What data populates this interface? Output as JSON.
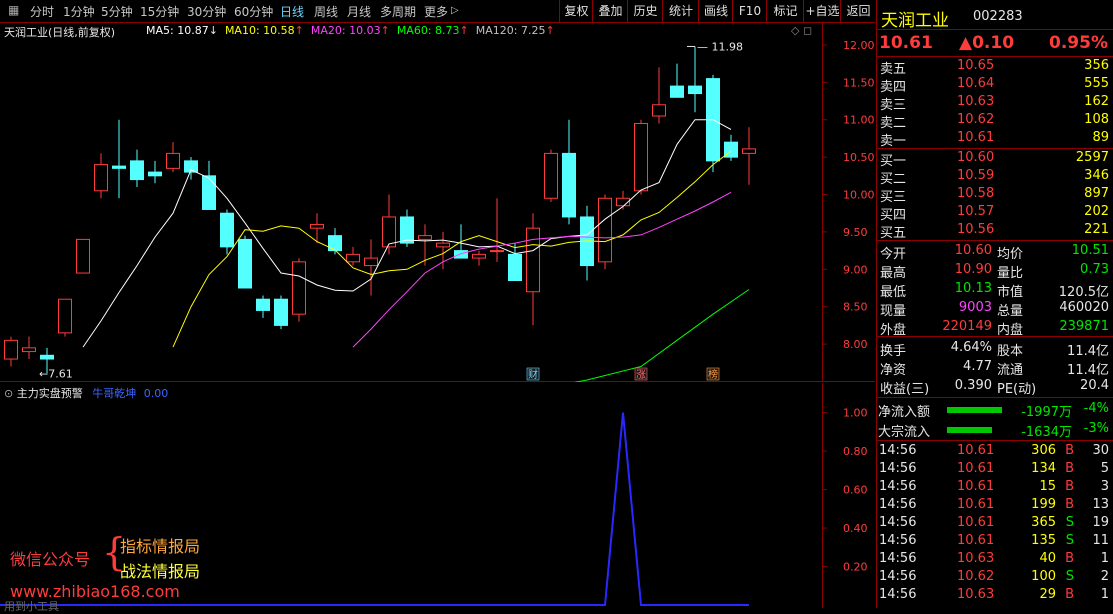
{
  "toolbar": {
    "periods": [
      {
        "label": "分时",
        "active": false
      },
      {
        "label": "1分钟",
        "active": false
      },
      {
        "label": "5分钟",
        "active": false
      },
      {
        "label": "15分钟",
        "active": false
      },
      {
        "label": "30分钟",
        "active": false
      },
      {
        "label": "60分钟",
        "active": false
      },
      {
        "label": "日线",
        "active": true
      },
      {
        "label": "周线",
        "active": false
      },
      {
        "label": "月线",
        "active": false
      },
      {
        "label": "多周期",
        "active": false
      },
      {
        "label": "更多",
        "active": false
      }
    ],
    "buttons": [
      "复权",
      "叠加",
      "历史",
      "统计",
      "画线",
      "F10",
      "标记",
      "+自选",
      "返回"
    ]
  },
  "main_chart": {
    "title": "天润工业(日线,前复权)",
    "ma_legend": [
      {
        "label": "MA5: 10.87",
        "arrow": "↓",
        "color": "#ffffff"
      },
      {
        "label": "MA10: 10.58",
        "arrow": "↑",
        "color": "#ffff00"
      },
      {
        "label": "MA20: 10.03",
        "arrow": "↑",
        "color": "#ff44ff"
      },
      {
        "label": "MA60: 8.73",
        "arrow": "↑",
        "color": "#00ff00"
      },
      {
        "label": "MA120: 7.25",
        "arrow": "↑",
        "color": "#c0c0c0"
      }
    ],
    "price_axis": [
      "12.00",
      "11.50",
      "11.00",
      "10.50",
      "10.00",
      "9.50",
      "9.00",
      "8.50",
      "8.00"
    ],
    "high_label": "11.98",
    "low_label": "7.61",
    "event_markers": [
      {
        "text": "财",
        "color": "#6ad6ff"
      },
      {
        "text": "涨",
        "color": "#ff6a6a"
      },
      {
        "text": "榜",
        "color": "#ff9b3c"
      }
    ]
  },
  "chart_data": {
    "type": "candlestick",
    "ylim": [
      7.6,
      12.2
    ],
    "candles": [
      {
        "o": 7.8,
        "h": 8.1,
        "l": 7.7,
        "c": 8.05
      },
      {
        "o": 7.9,
        "h": 8.1,
        "l": 7.8,
        "c": 7.95
      },
      {
        "o": 7.85,
        "h": 7.95,
        "l": 7.61,
        "c": 7.8
      },
      {
        "o": 8.15,
        "h": 8.6,
        "l": 8.1,
        "c": 8.6
      },
      {
        "o": 8.95,
        "h": 9.4,
        "l": 8.95,
        "c": 9.4
      },
      {
        "o": 10.05,
        "h": 10.55,
        "l": 9.95,
        "c": 10.4
      },
      {
        "o": 10.38,
        "h": 11.0,
        "l": 9.95,
        "c": 10.35
      },
      {
        "o": 10.45,
        "h": 10.6,
        "l": 10.1,
        "c": 10.2
      },
      {
        "o": 10.3,
        "h": 10.45,
        "l": 10.15,
        "c": 10.25
      },
      {
        "o": 10.35,
        "h": 10.7,
        "l": 10.3,
        "c": 10.55
      },
      {
        "o": 10.45,
        "h": 10.5,
        "l": 10.2,
        "c": 10.3
      },
      {
        "o": 10.25,
        "h": 10.45,
        "l": 9.8,
        "c": 9.8
      },
      {
        "o": 9.75,
        "h": 9.8,
        "l": 9.2,
        "c": 9.3
      },
      {
        "o": 9.4,
        "h": 9.45,
        "l": 8.75,
        "c": 8.75
      },
      {
        "o": 8.6,
        "h": 8.65,
        "l": 8.35,
        "c": 8.45
      },
      {
        "o": 8.6,
        "h": 8.65,
        "l": 8.2,
        "c": 8.25
      },
      {
        "o": 8.4,
        "h": 9.15,
        "l": 8.3,
        "c": 9.1
      },
      {
        "o": 9.55,
        "h": 9.75,
        "l": 9.35,
        "c": 9.6
      },
      {
        "o": 9.45,
        "h": 9.55,
        "l": 9.2,
        "c": 9.25
      },
      {
        "o": 9.1,
        "h": 9.3,
        "l": 9.05,
        "c": 9.2
      },
      {
        "o": 9.05,
        "h": 9.4,
        "l": 8.65,
        "c": 9.15
      },
      {
        "o": 9.3,
        "h": 10.0,
        "l": 9.2,
        "c": 9.7
      },
      {
        "o": 9.7,
        "h": 9.8,
        "l": 9.3,
        "c": 9.35
      },
      {
        "o": 9.4,
        "h": 9.6,
        "l": 9.05,
        "c": 9.45
      },
      {
        "o": 9.3,
        "h": 9.5,
        "l": 9.0,
        "c": 9.35
      },
      {
        "o": 9.25,
        "h": 9.6,
        "l": 9.15,
        "c": 9.15
      },
      {
        "o": 9.15,
        "h": 9.25,
        "l": 9.05,
        "c": 9.2
      },
      {
        "o": 9.25,
        "h": 9.95,
        "l": 9.1,
        "c": 9.25
      },
      {
        "o": 9.2,
        "h": 9.35,
        "l": 8.85,
        "c": 8.85
      },
      {
        "o": 8.7,
        "h": 9.75,
        "l": 8.25,
        "c": 9.55
      },
      {
        "o": 9.95,
        "h": 10.6,
        "l": 9.9,
        "c": 10.55
      },
      {
        "o": 10.55,
        "h": 11.0,
        "l": 9.6,
        "c": 9.7
      },
      {
        "o": 9.7,
        "h": 9.85,
        "l": 8.85,
        "c": 9.05
      },
      {
        "o": 9.1,
        "h": 10.0,
        "l": 9.0,
        "c": 9.95
      },
      {
        "o": 9.85,
        "h": 10.05,
        "l": 9.8,
        "c": 9.95
      },
      {
        "o": 10.05,
        "h": 11.0,
        "l": 10.0,
        "c": 10.95
      },
      {
        "o": 11.05,
        "h": 11.7,
        "l": 10.95,
        "c": 11.2
      },
      {
        "o": 11.45,
        "h": 11.75,
        "l": 11.3,
        "c": 11.3
      },
      {
        "o": 11.45,
        "h": 11.98,
        "l": 11.1,
        "c": 11.35
      },
      {
        "o": 11.55,
        "h": 11.6,
        "l": 10.3,
        "c": 10.45
      },
      {
        "o": 10.7,
        "h": 10.8,
        "l": 10.45,
        "c": 10.5
      },
      {
        "o": 10.55,
        "h": 10.9,
        "l": 10.13,
        "c": 10.61
      }
    ],
    "ma5": [
      null,
      null,
      null,
      null,
      7.96,
      8.31,
      8.69,
      9.05,
      9.43,
      9.75,
      10.33,
      10.22,
      9.95,
      9.62,
      9.28,
      8.95,
      8.91,
      8.79,
      8.72,
      8.71,
      8.87,
      9.34,
      9.39,
      9.38,
      9.39,
      9.35,
      9.3,
      9.31,
      9.21,
      9.25,
      9.41,
      9.44,
      9.46,
      9.67,
      9.84,
      10.06,
      10.16,
      10.67,
      11.0,
      11.0,
      10.87
    ],
    "ma10": [
      null,
      null,
      null,
      null,
      null,
      null,
      null,
      null,
      null,
      7.96,
      8.5,
      8.93,
      9.17,
      9.53,
      9.51,
      9.58,
      9.55,
      9.37,
      9.26,
      9.02,
      8.93,
      8.98,
      9.0,
      9.12,
      9.21,
      9.37,
      9.45,
      9.37,
      9.29,
      9.33,
      9.31,
      9.36,
      9.38,
      9.37,
      9.46,
      9.66,
      9.76,
      9.96,
      10.17,
      10.4,
      10.58
    ],
    "ma20": [
      null,
      null,
      null,
      null,
      null,
      null,
      null,
      null,
      null,
      null,
      null,
      null,
      null,
      null,
      null,
      null,
      null,
      null,
      null,
      7.96,
      8.2,
      8.46,
      8.7,
      8.95,
      9.1,
      9.21,
      9.27,
      9.31,
      9.35,
      9.4,
      9.42,
      9.44,
      9.43,
      9.42,
      9.43,
      9.46,
      9.56,
      9.67,
      9.78,
      9.9,
      10.03
    ],
    "ma60": [
      {
        "i": 25,
        "v": 7.27
      },
      {
        "i": 29,
        "v": 7.38
      },
      {
        "i": 32,
        "v": 7.52
      },
      {
        "i": 35,
        "v": 7.7
      },
      {
        "i": 37,
        "v": 8.05
      },
      {
        "i": 39,
        "v": 8.4
      },
      {
        "i": 41,
        "v": 8.73
      }
    ]
  },
  "indicator": {
    "title": "主力实盘预警",
    "series_name": "牛哥乾坤",
    "series_value": "0.00",
    "axis": [
      "1.00",
      "0.80",
      "0.60",
      "0.40",
      "0.20"
    ],
    "ylim": [
      0,
      1.05
    ],
    "values": [
      0,
      0,
      0,
      0,
      0,
      0,
      0,
      0,
      0,
      0,
      0,
      0,
      0,
      0,
      0,
      0,
      0,
      0,
      0,
      0,
      0,
      0,
      0,
      0,
      0,
      0,
      0,
      0,
      0,
      0,
      0,
      0,
      0,
      0,
      1,
      0,
      0,
      0,
      0,
      0,
      0,
      0
    ]
  },
  "watermark": {
    "wechat": "微信公众号",
    "line1": "指标情报局",
    "line2": "战法情报局",
    "site": "www.zhibiao168.com",
    "note": "用到小工具"
  },
  "quote": {
    "name": "天润工业",
    "code": "002283",
    "price": "10.61",
    "change": "▲0.10",
    "pct": "0.95%",
    "asks": [
      {
        "label": "卖五",
        "price": "10.65",
        "vol": "356"
      },
      {
        "label": "卖四",
        "price": "10.64",
        "vol": "555"
      },
      {
        "label": "卖三",
        "price": "10.63",
        "vol": "162"
      },
      {
        "label": "卖二",
        "price": "10.62",
        "vol": "108"
      },
      {
        "label": "卖一",
        "price": "10.61",
        "vol": "89"
      }
    ],
    "bids": [
      {
        "label": "买一",
        "price": "10.60",
        "vol": "2597"
      },
      {
        "label": "买二",
        "price": "10.59",
        "vol": "346"
      },
      {
        "label": "买三",
        "price": "10.58",
        "vol": "897"
      },
      {
        "label": "买四",
        "price": "10.57",
        "vol": "202"
      },
      {
        "label": "买五",
        "price": "10.56",
        "vol": "221"
      }
    ],
    "stats": [
      {
        "l1": "今开",
        "v1": "10.60",
        "c1": "red",
        "l2": "均价",
        "v2": "10.51",
        "c2": "green"
      },
      {
        "l1": "最高",
        "v1": "10.90",
        "c1": "red",
        "l2": "量比",
        "v2": "0.73",
        "c2": "green"
      },
      {
        "l1": "最低",
        "v1": "10.13",
        "c1": "green",
        "l2": "市值",
        "v2": "120.5亿",
        "c2": "white"
      },
      {
        "l1": "现量",
        "v1": "9003",
        "c1": "mag",
        "l2": "总量",
        "v2": "460020",
        "c2": "white"
      },
      {
        "l1": "外盘",
        "v1": "220149",
        "c1": "red",
        "l2": "内盘",
        "v2": "239871",
        "c2": "green"
      }
    ],
    "fin": [
      {
        "l1": "换手",
        "v1": "4.64%",
        "l2": "股本",
        "v2": "11.4亿"
      },
      {
        "l1": "净资",
        "v1": "4.77",
        "l2": "流通",
        "v2": "11.4亿"
      },
      {
        "l1": "收益(三)",
        "v1": "0.390",
        "l2": "PE(动)",
        "v2": "20.4"
      }
    ],
    "flows": [
      {
        "label": "净流入额",
        "value": "-1997万",
        "pct": "-4%",
        "bar": 0.55
      },
      {
        "label": "大宗流入",
        "value": "-1634万",
        "pct": "-3%",
        "bar": 0.45
      }
    ],
    "ticks": [
      {
        "t": "14:56",
        "p": "10.61",
        "v": "306",
        "s": "B",
        "n": "30"
      },
      {
        "t": "14:56",
        "p": "10.61",
        "v": "134",
        "s": "B",
        "n": "5"
      },
      {
        "t": "14:56",
        "p": "10.61",
        "v": "15",
        "s": "B",
        "n": "3"
      },
      {
        "t": "14:56",
        "p": "10.61",
        "v": "199",
        "s": "B",
        "n": "13"
      },
      {
        "t": "14:56",
        "p": "10.61",
        "v": "365",
        "s": "S",
        "n": "19"
      },
      {
        "t": "14:56",
        "p": "10.61",
        "v": "135",
        "s": "S",
        "n": "11"
      },
      {
        "t": "14:56",
        "p": "10.63",
        "v": "40",
        "s": "B",
        "n": "1"
      },
      {
        "t": "14:56",
        "p": "10.62",
        "v": "100",
        "s": "S",
        "n": "2"
      },
      {
        "t": "14:56",
        "p": "10.63",
        "v": "29",
        "s": "B",
        "n": "1"
      }
    ]
  }
}
